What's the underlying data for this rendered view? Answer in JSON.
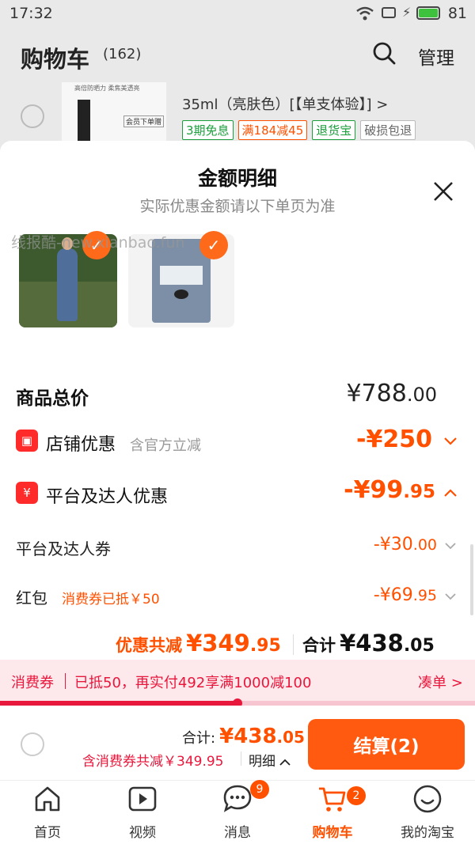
{
  "status": {
    "time": "17:32",
    "battery": "81"
  },
  "header": {
    "title": "购物车",
    "count": "(162)",
    "manage": "管理"
  },
  "bg_item": {
    "product_line": "35ml（亮肤色）[【单支体验】] >",
    "thumb_caption": "高倍防晒力 柔焦美透亮",
    "thumb_badge": "会员下单赠",
    "tags": [
      {
        "label": "3期免息",
        "color": "#1a9e3a"
      },
      {
        "label": "满184减45",
        "color": "#ff5000"
      },
      {
        "label": "退货宝",
        "color": "#1a9e3a"
      },
      {
        "label": "破损包退",
        "color": "#666666"
      }
    ]
  },
  "sheet": {
    "title": "金额明细",
    "subtitle": "实际优惠金额请以下单页为准",
    "watermark": "线报酷-new.xianbao.fun",
    "rows": {
      "total_label": "商品总价",
      "total_main": "¥788",
      "total_dec": ".00",
      "shop_label": "店铺优惠",
      "shop_note": "含官方立减",
      "shop_amount": "-¥250",
      "platform_label": "平台及达人优惠",
      "platform_main": "-¥99",
      "platform_dec": ".95",
      "coupon_label": "平台及达人券",
      "coupon_main": "-¥30",
      "coupon_dec": ".00",
      "redpack_label": "红包",
      "redpack_note": "消费券已抵￥50",
      "redpack_main": "-¥69",
      "redpack_dec": ".95"
    },
    "summary": {
      "discount_label": "优惠共减",
      "discount_main": "¥349",
      "discount_dec": ".95",
      "sum_label": "合计",
      "sum_main": "¥438",
      "sum_dec": ".05"
    }
  },
  "voucher_bar": {
    "tag": "消费券",
    "text": "已抵50，再实付492享满1000减100",
    "action": "凑单 >",
    "progress": 0.5
  },
  "checkout": {
    "sum_label": "合计:",
    "sum_main": "¥438",
    "sum_dec": ".05",
    "discount_text": "含消费券共减￥349.95",
    "detail_link": "明细",
    "button": "结算(2)"
  },
  "tabs": [
    {
      "label": "首页",
      "icon": "home-icon"
    },
    {
      "label": "视频",
      "icon": "video-icon"
    },
    {
      "label": "消息",
      "icon": "message-icon",
      "badge": "9"
    },
    {
      "label": "购物车",
      "icon": "cart-icon",
      "badge": "2",
      "active": true
    },
    {
      "label": "我的淘宝",
      "icon": "profile-icon"
    }
  ],
  "colors": {
    "accent": "#ff5000",
    "red": "#ff2b2b",
    "pink_bar": "#fde8ec"
  }
}
